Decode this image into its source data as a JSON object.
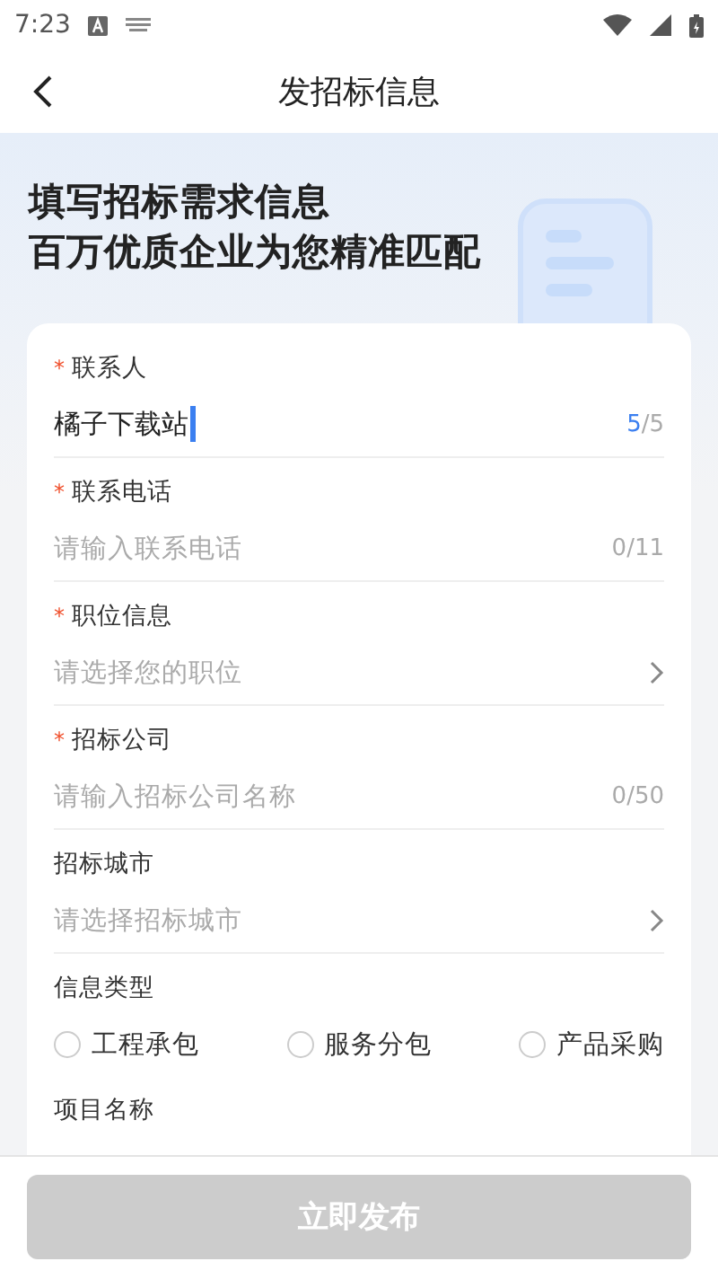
{
  "status_bar": {
    "time": "7:23"
  },
  "header": {
    "title": "发招标信息"
  },
  "banner": {
    "line_1": "填写**招标**需求信息",
    "line_2": "百万优质企业为您精准匹配"
  },
  "fields": [
    {
      "kind": "text",
      "label": "联系人",
      "required_mark": "*",
      "value": "橘子下载站",
      "focused": true,
      "count": "5",
      "max": "/5"
    },
    {
      "kind": "text",
      "label": "联系电话",
      "required_mark": "*",
      "placeholder": "请输入联系电话",
      "count": "0",
      "max": "/11"
    },
    {
      "kind": "select",
      "label": "职位信息",
      "required_mark": "*",
      "placeholder": "请选择您的职位"
    },
    {
      "kind": "text",
      "label": "招标公司",
      "required_mark": "*",
      "placeholder": "请输入招标公司名称",
      "count": "0",
      "max": "/50"
    },
    {
      "kind": "select",
      "label": "招标城市",
      "placeholder": "请选择招标城市"
    },
    {
      "kind": "radio",
      "label": "信息类型",
      "options": [
        {
          "label": "工程承包",
          "selected": false
        },
        {
          "label": "服务分包",
          "selected": false
        },
        {
          "label": "产品采购",
          "selected": false
        }
      ]
    },
    {
      "kind": "heading",
      "label": "项目名称"
    }
  ],
  "submit": {
    "label": "立即发布",
    "disabled": true
  }
}
